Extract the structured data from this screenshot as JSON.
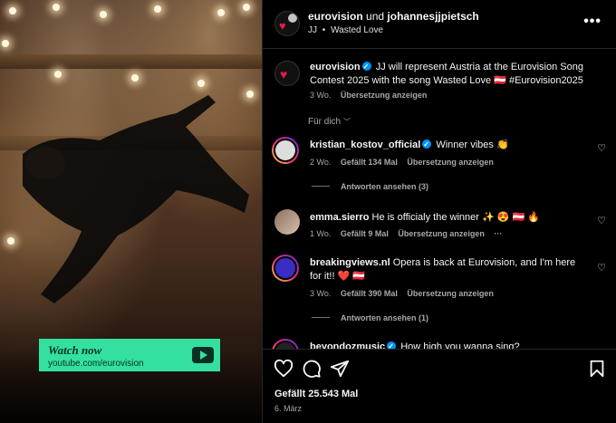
{
  "media": {
    "watch_now": "Watch now",
    "url": "youtube.com/eurovision"
  },
  "header": {
    "account": "eurovision",
    "joiner": "und",
    "collab": "johannesjjpietsch",
    "subtitle_artist": "JJ",
    "subtitle_sep": "•",
    "subtitle_song": "Wasted Love"
  },
  "caption": {
    "user": "eurovision",
    "text": "JJ will represent Austria at the Eurovision Song Contest 2025 with the song Wasted Love 🇦🇹 #Eurovision2025",
    "age": "3 Wo.",
    "translate": "Übersetzung anzeigen"
  },
  "filter_label": "Für dich",
  "comments": [
    {
      "user": "kristian_kostov_official",
      "verified": true,
      "text": "Winner vibes 👏",
      "age": "2 Wo.",
      "likes": "Gefällt 134 Mal",
      "translate": "Übersetzung anzeigen",
      "replies": "Antworten ansehen (3)"
    },
    {
      "user": "emma.sierro",
      "verified": false,
      "text": "He is officialy the winner ✨ 😍 🇦🇹 🔥",
      "age": "1 Wo.",
      "likes": "Gefällt 9 Mal",
      "translate": "Übersetzung anzeigen",
      "more": "···"
    },
    {
      "user": "breakingviews.nl",
      "verified": false,
      "text": "Opera is back at Eurovision, and I'm here for it!! ❤️ 🇦🇹",
      "age": "3 Wo.",
      "likes": "Gefällt 390 Mal",
      "translate": "Übersetzung anzeigen",
      "replies": "Antworten ansehen (1)"
    },
    {
      "user": "beyondozmusic",
      "verified": true,
      "text": "How high you wanna sing?"
    }
  ],
  "footer": {
    "likes": "Gefällt 25.543 Mal",
    "date": "6. März"
  },
  "icons": {
    "like": "heart-icon",
    "comment": "comment-icon",
    "share": "share-icon",
    "save": "bookmark-icon",
    "more": "more-icon"
  }
}
